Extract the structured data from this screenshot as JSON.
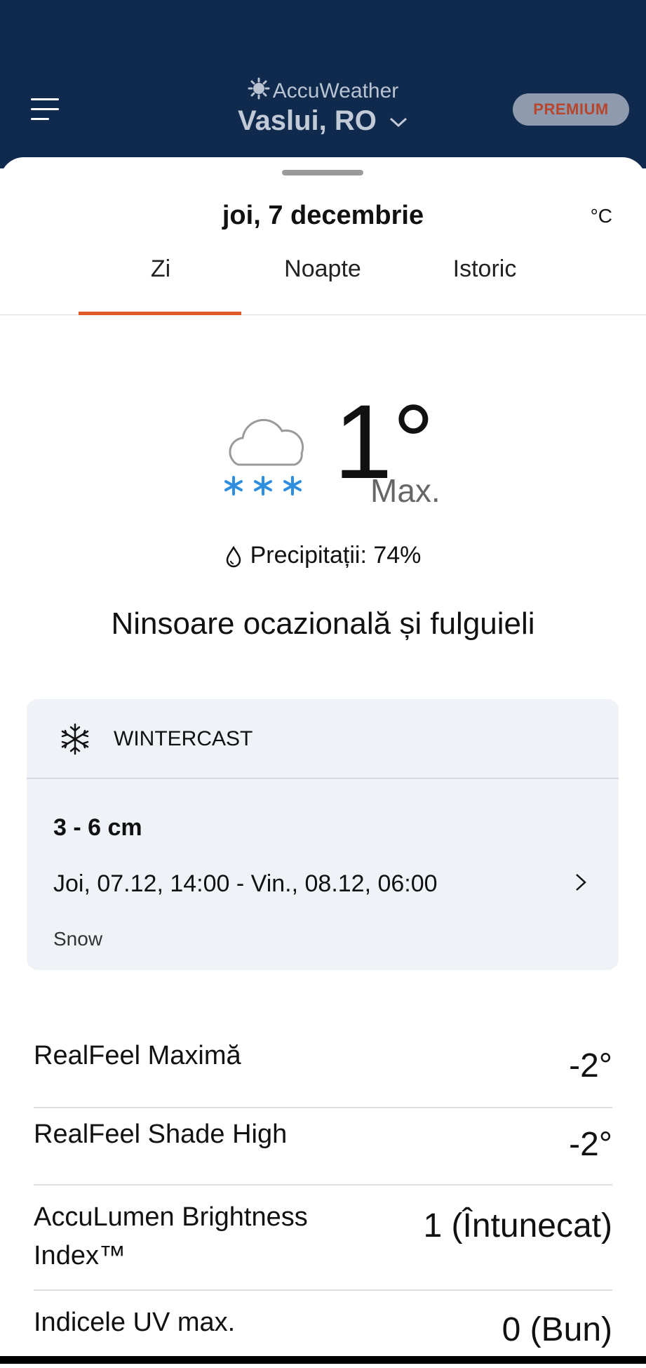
{
  "header": {
    "brand": "AccuWeather",
    "location": "Vaslui, RO",
    "premium_label": "PREMIUM",
    "menu_icon": "hamburger-menu-icon",
    "chevron_icon": "chevron-down-icon"
  },
  "sheet": {
    "date": "joi, 7 decembrie",
    "unit": "°C",
    "tabs": [
      {
        "label": "Zi",
        "active": true
      },
      {
        "label": "Noapte",
        "active": false
      },
      {
        "label": "Istoric",
        "active": false
      }
    ]
  },
  "forecast": {
    "icon": "cloud-snow-icon",
    "temperature": "1°",
    "temp_label": "Max.",
    "precip_icon": "drop-icon",
    "precipitation": "Precipitații: 74%",
    "phrase": "Ninsoare ocazională și fulguieli"
  },
  "wintercast": {
    "icon": "snowflake-icon",
    "title": "WINTERCAST",
    "amount": "3 - 6 cm",
    "range": "Joi, 07.12, 14:00 - Vin., 08.12, 06:00",
    "type": "Snow",
    "chevron_icon": "chevron-right-icon"
  },
  "details": [
    {
      "label": "RealFeel Maximă",
      "value": "-2°"
    },
    {
      "label": "RealFeel Shade High",
      "value": "-2°"
    },
    {
      "label": "AccuLumen Brightness Index™",
      "value": "1 (Întunecat)"
    },
    {
      "label": "Indicele UV max.",
      "value": "0 (Bun)"
    }
  ],
  "colors": {
    "header_bg": "#0f2a4d",
    "accent": "#e05a2a",
    "snow_blue": "#2f8ee0",
    "card_bg": "#eff2f7"
  }
}
